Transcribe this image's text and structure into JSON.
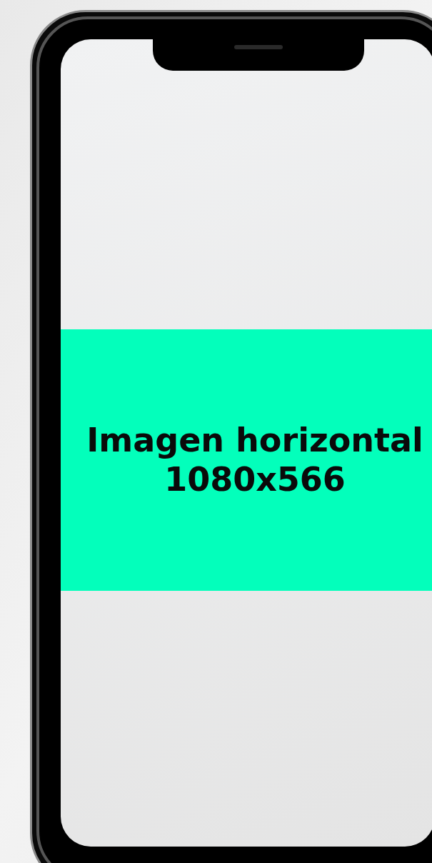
{
  "screen": {
    "banner": {
      "title": "Imagen horizontal",
      "subtitle": "1080x566"
    }
  }
}
